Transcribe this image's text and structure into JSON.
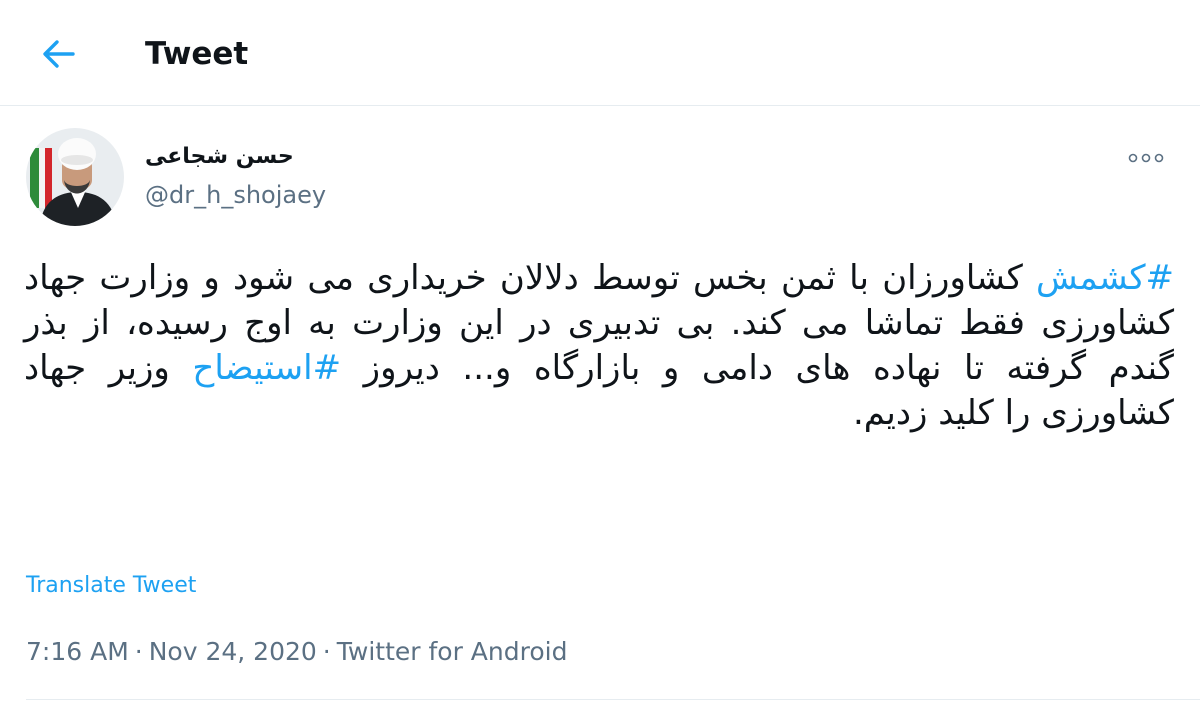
{
  "header": {
    "title": "Tweet",
    "back_icon": "arrow-left-icon"
  },
  "tweet": {
    "author": {
      "name": "حسن شجاعی",
      "handle": "@dr_h_shojaey"
    },
    "more_icon": "more-horizontal-icon",
    "text": {
      "hashtag_1": "#کشمش",
      "segment_1": " کشاورزان با ثمن بخس توسط دلالان خریداری می شود و وزارت جهاد کشاورزی فقط تماشا می کند. بی تدبیری در این وزارت به اوج رسیده، از بذر گندم گرفته تا نهاده های دامی و بازارگاه و... دیروز ",
      "hashtag_2": "#استیضاح",
      "segment_2": " وزیر جهاد کشاورزی را کلید زدیم."
    },
    "translate_label": "Translate Tweet",
    "meta": {
      "time": "7:16 AM",
      "date": "Nov 24, 2020",
      "separator": "·",
      "source": "Twitter for Android"
    }
  },
  "colors": {
    "accent": "#1da1f2",
    "text_primary": "#0f1419",
    "text_secondary": "#5b7083",
    "divider": "#e6ecf0"
  }
}
